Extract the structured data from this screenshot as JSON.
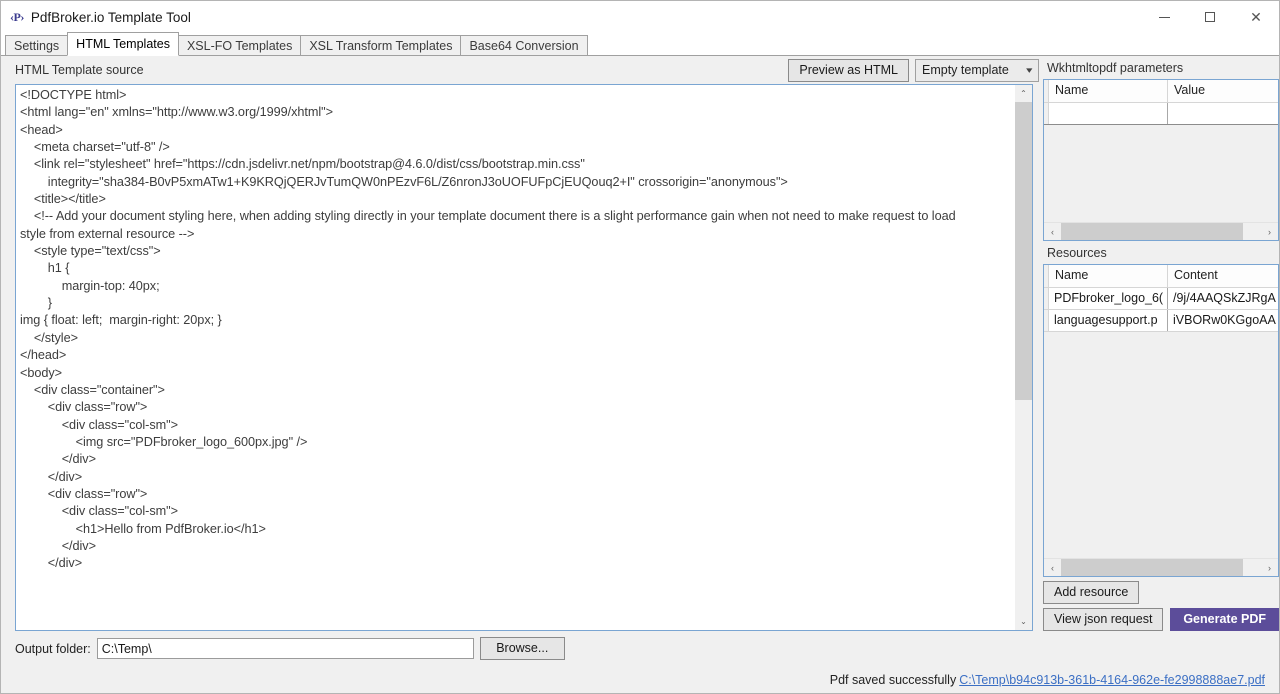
{
  "window": {
    "icon": "pdfbroker-logo-icon",
    "icon_glyph": "‹P›",
    "title": "PdfBroker.io Template Tool",
    "controls": {
      "minimize": "minimize-icon",
      "maximize": "maximize-icon",
      "close": "close-icon"
    }
  },
  "tabs": [
    {
      "label": "Settings",
      "active": false
    },
    {
      "label": "HTML Templates",
      "active": true
    },
    {
      "label": "XSL-FO Templates",
      "active": false
    },
    {
      "label": "XSL Transform Templates",
      "active": false
    },
    {
      "label": "Base64 Conversion",
      "active": false
    }
  ],
  "source_panel": {
    "label": "HTML Template source",
    "preview_button": "Preview as HTML",
    "template_select": {
      "value": "Empty template",
      "options": [
        "Empty template"
      ]
    }
  },
  "editor": {
    "lines": [
      "<!DOCTYPE html>",
      "<html lang=\"en\" xmlns=\"http://www.w3.org/1999/xhtml\">",
      "",
      "<head>",
      "    <meta charset=\"utf-8\" />",
      "    <link rel=\"stylesheet\" href=\"https://cdn.jsdelivr.net/npm/bootstrap@4.6.0/dist/css/bootstrap.min.css\"",
      "        integrity=\"sha384-B0vP5xmATw1+K9KRQjQERJvTumQW0nPEzvF6L/Z6nronJ3oUOFUFpCjEUQouq2+I\" crossorigin=\"anonymous\">",
      "    <title></title>",
      "    <!-- Add your document styling here, when adding styling directly in your template document there is a slight performance gain when not need to make request to load",
      "style from external resource -->",
      "    <style type=\"text/css\">",
      "        h1 {",
      "            margin-top: 40px;",
      "        }",
      "img { float: left;  margin-right: 20px; }",
      "    </style>",
      "</head>",
      "",
      "<body>",
      "    <div class=\"container\">",
      "        <div class=\"row\">",
      "            <div class=\"col-sm\">",
      "                <img src=\"PDFbroker_logo_600px.jpg\" />",
      "            </div>",
      "        </div>",
      "        <div class=\"row\">",
      "            <div class=\"col-sm\">",
      "                <h1>Hello from PdfBroker.io</h1>",
      "            </div>",
      "        </div>"
    ],
    "scroll": {
      "up_arrow": "chevron-up-icon",
      "down_arrow": "chevron-down-icon"
    }
  },
  "params_panel": {
    "label": "Wkhtmltopdf parameters",
    "columns": [
      "Name",
      "Value"
    ],
    "rows": [
      {
        "name": "",
        "value": ""
      }
    ]
  },
  "resources_panel": {
    "label": "Resources",
    "columns": [
      "Name",
      "Content"
    ],
    "rows": [
      {
        "name": "PDFbroker_logo_6(",
        "content": "/9j/4AAQSkZJRgA"
      },
      {
        "name": "languagesupport.p",
        "content": "iVBORw0KGgoAA"
      }
    ],
    "add_button": "Add resource"
  },
  "actions": {
    "view_json": "View json request",
    "generate_pdf": "Generate PDF",
    "generate_pdf_color": "#5c4d9a"
  },
  "output": {
    "label": "Output folder:",
    "value": "C:\\Temp\\",
    "placeholder": "",
    "browse_button": "Browse..."
  },
  "status": {
    "message": "Pdf saved successfully",
    "link": "C:\\Temp\\b94c913b-361b-4164-962e-fe2998888ae7.pdf",
    "link_color": "#3b6fc4"
  },
  "scroll_glyphs": {
    "left": "‹",
    "right": "›",
    "up": "⌃",
    "down": "⌄"
  }
}
